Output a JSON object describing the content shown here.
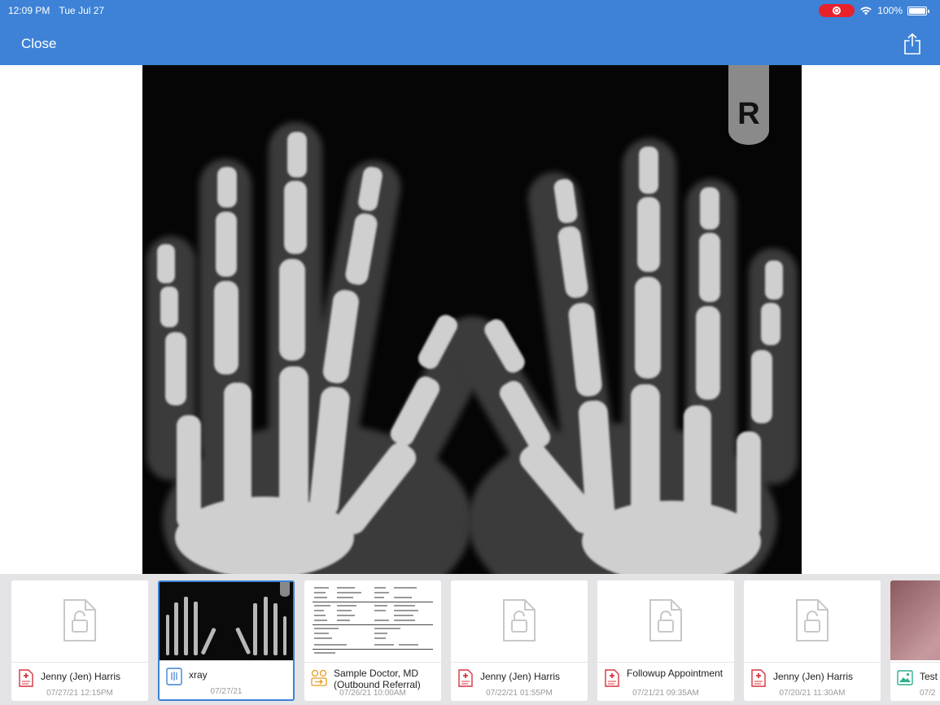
{
  "status_bar": {
    "time": "12:09 PM",
    "date": "Tue Jul 27",
    "battery": "100%"
  },
  "nav": {
    "close_label": "Close",
    "share_icon": "share-icon"
  },
  "viewer": {
    "marker_letter": "R"
  },
  "attachments": [
    {
      "title": "Jenny (Jen) Harris",
      "date": "07/27/21 12:15PM",
      "icon": "pdf-icon",
      "thumb": "locked"
    },
    {
      "title": "xray",
      "date": "07/27/21",
      "icon": "image-icon",
      "thumb": "xray",
      "selected": true
    },
    {
      "title": "Sample Doctor, MD (Outbound Referral)",
      "date": "07/26/21 10:00AM",
      "icon": "referral-icon",
      "thumb": "document"
    },
    {
      "title": "Jenny (Jen) Harris",
      "date": "07/22/21 01:55PM",
      "icon": "pdf-icon",
      "thumb": "locked"
    },
    {
      "title": "Followup Appointment",
      "date": "07/21/21 09:35AM",
      "icon": "pdf-icon",
      "thumb": "locked"
    },
    {
      "title": "Jenny (Jen) Harris",
      "date": "07/20/21 11:30AM",
      "icon": "pdf-icon",
      "thumb": "locked"
    },
    {
      "title": "Test",
      "date": "07/2",
      "icon": "photo-icon",
      "thumb": "photo"
    }
  ],
  "colors": {
    "accent": "#3d82d6",
    "record": "#e8212b",
    "pdf": "#d9333f",
    "referral": "#e89b1e"
  }
}
